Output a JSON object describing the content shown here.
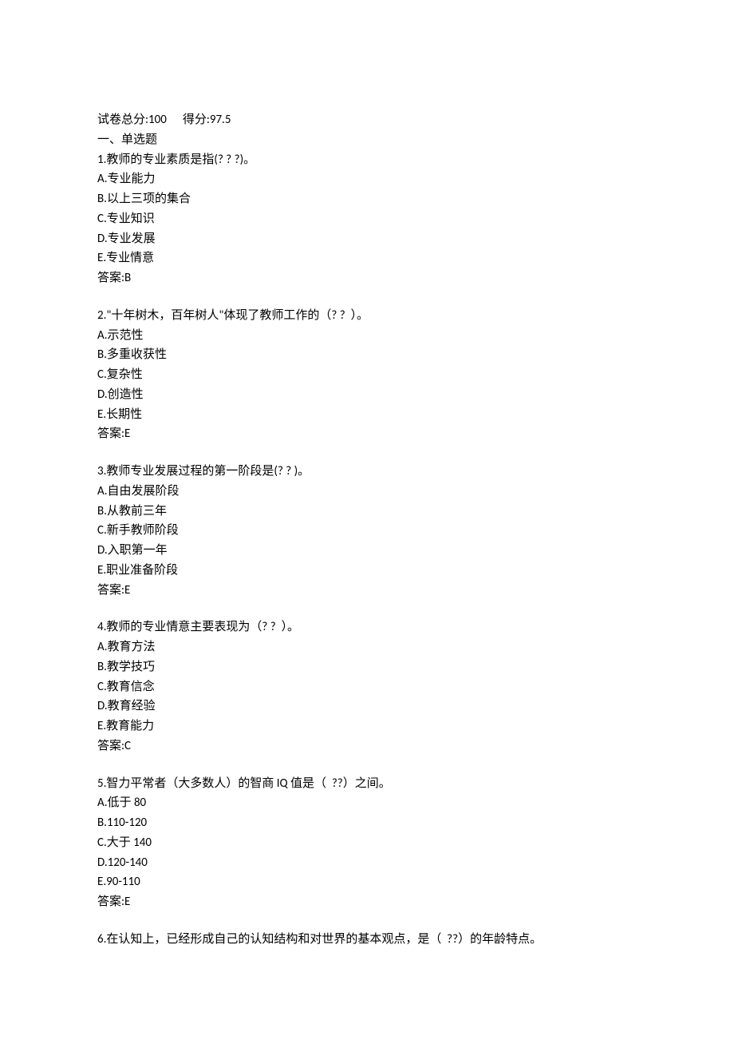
{
  "header": {
    "total_label": "试卷总分:",
    "total_value": "100",
    "score_label": "得分:",
    "score_value": "97.5",
    "section_title": "一、单选题"
  },
  "questions": [
    {
      "stem": "1.教师的专业素质是指(? ? ?)。",
      "options": [
        "A.专业能力",
        "B.以上三项的集合",
        "C.专业知识",
        "D.专业发展",
        "E.专业情意"
      ],
      "answer": "答案:B"
    },
    {
      "stem": "2.\"十年树木，百年树人\"体现了教师工作的（? ?  ）。",
      "options": [
        "A.示范性",
        "B.多重收获性",
        "C.复杂性",
        "D.创造性",
        "E.长期性"
      ],
      "answer": "答案:E"
    },
    {
      "stem": "3.教师专业发展过程的第一阶段是(? ? )。",
      "options": [
        "A.自由发展阶段",
        "B.从教前三年",
        "C.新手教师阶段",
        "D.入职第一年",
        "E.职业准备阶段"
      ],
      "answer": "答案:E"
    },
    {
      "stem": "4.教师的专业情意主要表现为（? ?  ）。",
      "options": [
        "A.教育方法",
        "B.教学技巧",
        "C.教育信念",
        "D.教育经验",
        "E.教育能力"
      ],
      "answer": "答案:C"
    },
    {
      "stem": "5.智力平常者（大多数人）的智商 IQ 值是（  ??）之间。",
      "options": [
        "A.低于 80",
        "B.110-120",
        "C.大于 140",
        "D.120-140",
        "E.90-110"
      ],
      "answer": "答案:E"
    },
    {
      "stem": "6.在认知上，已经形成自己的认知结构和对世界的基本观点，是（  ??）的年龄特点。",
      "options": [],
      "answer": ""
    }
  ]
}
